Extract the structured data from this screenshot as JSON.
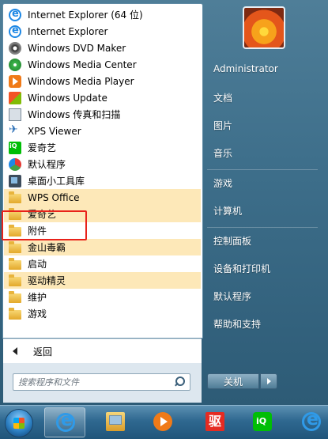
{
  "programs": [
    {
      "label": "Internet Explorer (64 位)",
      "icon": "ie-icon",
      "folder": false,
      "highlight": false
    },
    {
      "label": "Internet Explorer",
      "icon": "ie-icon",
      "folder": false,
      "highlight": false
    },
    {
      "label": "Windows DVD Maker",
      "icon": "dvd-icon",
      "folder": false,
      "highlight": false
    },
    {
      "label": "Windows Media Center",
      "icon": "wmc-icon",
      "folder": false,
      "highlight": false
    },
    {
      "label": "Windows Media Player",
      "icon": "wmp-icon",
      "folder": false,
      "highlight": false
    },
    {
      "label": "Windows Update",
      "icon": "update-icon",
      "folder": false,
      "highlight": false
    },
    {
      "label": "Windows 传真和扫描",
      "icon": "fax-icon",
      "folder": false,
      "highlight": false
    },
    {
      "label": "XPS Viewer",
      "icon": "xps-icon",
      "folder": false,
      "highlight": false
    },
    {
      "label": "爱奇艺",
      "icon": "iqiyi-icon",
      "folder": false,
      "highlight": false
    },
    {
      "label": "默认程序",
      "icon": "default-icon",
      "folder": false,
      "highlight": false
    },
    {
      "label": "桌面小工具库",
      "icon": "gadget-icon",
      "folder": false,
      "highlight": false
    },
    {
      "label": "WPS Office",
      "icon": "folder-icon",
      "folder": true,
      "highlight": true
    },
    {
      "label": "爱奇艺",
      "icon": "folder-icon",
      "folder": true,
      "highlight": true
    },
    {
      "label": "附件",
      "icon": "folder-icon",
      "folder": true,
      "highlight": false
    },
    {
      "label": "金山毒霸",
      "icon": "folder-icon",
      "folder": true,
      "highlight": true
    },
    {
      "label": "启动",
      "icon": "folder-icon",
      "folder": true,
      "highlight": false
    },
    {
      "label": "驱动精灵",
      "icon": "folder-icon",
      "folder": true,
      "highlight": true
    },
    {
      "label": "维护",
      "icon": "folder-icon",
      "folder": true,
      "highlight": false
    },
    {
      "label": "游戏",
      "icon": "folder-icon",
      "folder": true,
      "highlight": false
    }
  ],
  "back_label": "返回",
  "search": {
    "placeholder": "搜索程序和文件"
  },
  "right_items": [
    {
      "label": "Administrator",
      "name": "user-name"
    },
    {
      "label": "文档",
      "name": "documents"
    },
    {
      "label": "图片",
      "name": "pictures"
    },
    {
      "label": "音乐",
      "name": "music"
    },
    {
      "label": "游戏",
      "name": "games"
    },
    {
      "label": "计算机",
      "name": "computer"
    },
    {
      "label": "控制面板",
      "name": "control-panel"
    },
    {
      "label": "设备和打印机",
      "name": "devices-and-printers"
    },
    {
      "label": "默认程序",
      "name": "default-programs"
    },
    {
      "label": "帮助和支持",
      "name": "help-and-support"
    }
  ],
  "shutdown_label": "关机",
  "taskbar": {
    "qudong_glyph": "驱",
    "items": [
      "ie-icon",
      "explorer-icon",
      "media-player-icon",
      "driver-genius-icon",
      "iqiyi-icon",
      "ie-icon"
    ]
  },
  "colors": {
    "highlight_folder": "#fde8b8",
    "annotation_box": "#e8221a"
  }
}
